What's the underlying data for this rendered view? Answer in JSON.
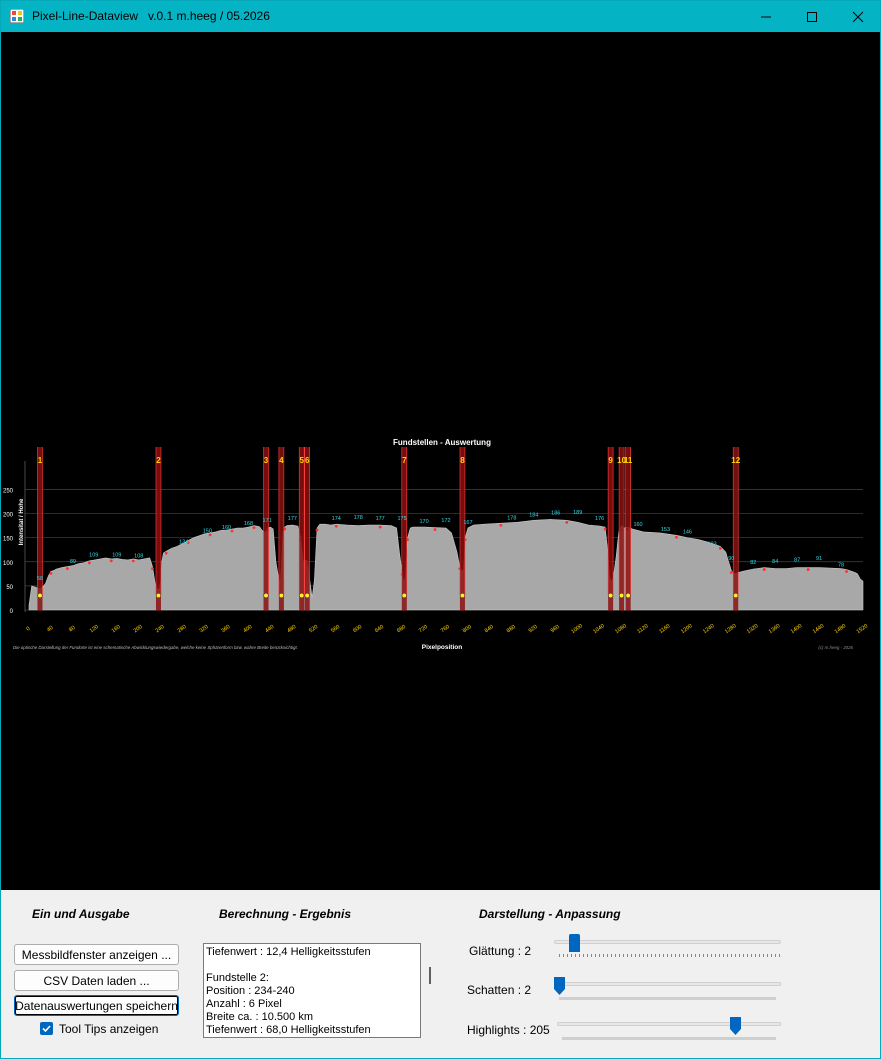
{
  "window": {
    "title": "Pixel-Line-Dataview   v.0.1 m.heeg / 05.2026",
    "colors": {
      "titlebar": "#04b4c4",
      "canvas": "#000000",
      "accent": "#0067c0"
    }
  },
  "chart_data": {
    "type": "area",
    "title": "Fundstellen - Auswertung",
    "xlabel": "Pixelposition",
    "ylabel": "Intensitat / Hohe",
    "xlim": [
      0,
      1520
    ],
    "ylim": [
      0,
      280
    ],
    "x_ticks": [
      "0",
      "40",
      "80",
      "120",
      "160",
      "200",
      "240",
      "280",
      "320",
      "360",
      "400",
      "440",
      "480",
      "520",
      "560",
      "600",
      "640",
      "680",
      "720",
      "760",
      "800",
      "840",
      "880",
      "920",
      "960",
      "1000",
      "1040",
      "1080",
      "1120",
      "1160",
      "1200",
      "1240",
      "1280",
      "1320",
      "1360",
      "1400",
      "1440",
      "1480",
      "1520"
    ],
    "y_ticks": [
      "0",
      "50",
      "100",
      "150",
      "200",
      "250"
    ],
    "grid": true,
    "note": "Die optische Darstellung der Fundorte ist eine schematische Abwicklungswiedergabe, welche keine Sphärenform bzw. wahre Breite berücksichtigt.",
    "copyright": "(c) m.heeg - 2026",
    "profile_x": [
      0,
      5,
      10,
      15,
      20,
      25,
      30,
      35,
      40,
      45,
      50,
      60,
      70,
      80,
      90,
      100,
      110,
      120,
      130,
      140,
      150,
      160,
      170,
      180,
      190,
      200,
      210,
      220,
      225,
      230,
      234,
      236,
      238,
      240,
      242,
      245,
      250,
      260,
      270,
      280,
      290,
      300,
      310,
      320,
      330,
      340,
      350,
      360,
      370,
      380,
      390,
      400,
      410,
      420,
      425,
      430,
      435,
      440,
      445,
      450,
      455,
      458,
      460,
      463,
      466,
      470,
      480,
      490,
      495,
      500,
      503,
      505,
      508,
      512,
      516,
      520,
      525,
      530,
      540,
      550,
      560,
      580,
      600,
      620,
      640,
      660,
      670,
      675,
      680,
      682,
      684,
      686,
      690,
      695,
      700,
      720,
      740,
      760,
      770,
      780,
      785,
      788,
      790,
      792,
      795,
      800,
      810,
      830,
      860,
      890,
      920,
      950,
      980,
      1000,
      1020,
      1040,
      1050,
      1055,
      1058,
      1060,
      1062,
      1065,
      1070,
      1075,
      1078,
      1080,
      1082,
      1085,
      1090,
      1100,
      1120,
      1150,
      1180,
      1200,
      1220,
      1240,
      1260,
      1270,
      1275,
      1278,
      1280,
      1285,
      1300,
      1320,
      1340,
      1360,
      1380,
      1400,
      1420,
      1440,
      1460,
      1480,
      1490,
      1500,
      1505,
      1510,
      1515,
      1520
    ],
    "profile_y": [
      10,
      50,
      48,
      46,
      44,
      48,
      55,
      70,
      80,
      82,
      85,
      88,
      90,
      92,
      96,
      98,
      102,
      104,
      106,
      108,
      106,
      107,
      105,
      104,
      106,
      104,
      106,
      108,
      90,
      55,
      44,
      43,
      45,
      60,
      100,
      118,
      122,
      128,
      132,
      138,
      144,
      150,
      154,
      158,
      160,
      162,
      165,
      166,
      168,
      170,
      170,
      172,
      175,
      173,
      165,
      160,
      170,
      172,
      168,
      100,
      65,
      60,
      90,
      160,
      172,
      175,
      176,
      174,
      150,
      98,
      102,
      104,
      100,
      60,
      26,
      60,
      170,
      178,
      178,
      176,
      178,
      176,
      175,
      176,
      176,
      175,
      170,
      120,
      78,
      62,
      60,
      70,
      150,
      170,
      172,
      172,
      171,
      170,
      160,
      120,
      90,
      82,
      80,
      85,
      150,
      170,
      176,
      178,
      180,
      182,
      186,
      188,
      186,
      182,
      176,
      174,
      172,
      120,
      70,
      62,
      60,
      68,
      110,
      162,
      170,
      175,
      172,
      170,
      172,
      168,
      162,
      160,
      155,
      150,
      146,
      140,
      132,
      120,
      100,
      90,
      82,
      75,
      80,
      85,
      88,
      86,
      86,
      88,
      88,
      88,
      87,
      86,
      84,
      80,
      78,
      75,
      64,
      60,
      50,
      30,
      20
    ],
    "markers": [
      {
        "label": "1",
        "x": 20
      },
      {
        "label": "2",
        "x": 236
      },
      {
        "label": "3",
        "x": 432
      },
      {
        "label": "4",
        "x": 460
      },
      {
        "label": "5",
        "x": 497
      },
      {
        "label": "6",
        "x": 507
      },
      {
        "label": "7",
        "x": 684
      },
      {
        "label": "8",
        "x": 790
      },
      {
        "label": "9",
        "x": 1060
      },
      {
        "label": "10",
        "x": 1080
      },
      {
        "label": "11",
        "x": 1092
      },
      {
        "label": "12",
        "x": 1288
      }
    ],
    "value_labels": [
      {
        "x": 20,
        "y": 56,
        "text": "58"
      },
      {
        "x": 80,
        "y": 91,
        "text": "89"
      },
      {
        "x": 118,
        "y": 105,
        "text": "109"
      },
      {
        "x": 160,
        "y": 105,
        "text": "109"
      },
      {
        "x": 200,
        "y": 103,
        "text": "108"
      },
      {
        "x": 282,
        "y": 132,
        "text": "134"
      },
      {
        "x": 325,
        "y": 155,
        "text": "150"
      },
      {
        "x": 360,
        "y": 162,
        "text": "160"
      },
      {
        "x": 400,
        "y": 170,
        "text": "168"
      },
      {
        "x": 434,
        "y": 176,
        "text": "171"
      },
      {
        "x": 480,
        "y": 180,
        "text": "177"
      },
      {
        "x": 560,
        "y": 180,
        "text": "174"
      },
      {
        "x": 600,
        "y": 183,
        "text": "178"
      },
      {
        "x": 640,
        "y": 180,
        "text": "177"
      },
      {
        "x": 680,
        "y": 180,
        "text": "175"
      },
      {
        "x": 720,
        "y": 174,
        "text": "170"
      },
      {
        "x": 760,
        "y": 176,
        "text": "172"
      },
      {
        "x": 800,
        "y": 172,
        "text": "167"
      },
      {
        "x": 880,
        "y": 182,
        "text": "178"
      },
      {
        "x": 920,
        "y": 188,
        "text": "184"
      },
      {
        "x": 960,
        "y": 192,
        "text": "186"
      },
      {
        "x": 1000,
        "y": 193,
        "text": "189"
      },
      {
        "x": 1040,
        "y": 180,
        "text": "176"
      },
      {
        "x": 1110,
        "y": 168,
        "text": "160"
      },
      {
        "x": 1160,
        "y": 158,
        "text": "153"
      },
      {
        "x": 1200,
        "y": 152,
        "text": "146"
      },
      {
        "x": 1245,
        "y": 128,
        "text": "123"
      },
      {
        "x": 1280,
        "y": 97,
        "text": "90"
      },
      {
        "x": 1320,
        "y": 89,
        "text": "82"
      },
      {
        "x": 1360,
        "y": 91,
        "text": "84"
      },
      {
        "x": 1400,
        "y": 94,
        "text": "87"
      },
      {
        "x": 1440,
        "y": 98,
        "text": "91"
      },
      {
        "x": 1480,
        "y": 84,
        "text": "78"
      }
    ]
  },
  "panels": {
    "io": {
      "heading": "Ein und Ausgabe",
      "btn_show": "Messbildfenster anzeigen ...",
      "btn_csv": "CSV Daten laden ...",
      "btn_save": "Datenauswertungen speichern",
      "tooltips_label": "Tool Tips anzeigen",
      "tooltips_checked": true
    },
    "result": {
      "heading": "Berechnung - Ergebnis",
      "lines": [
        "Tiefenwert : 12,4 Helligkeitsstufen",
        "",
        "Fundstelle 2:",
        "Position : 234-240",
        "Anzahl : 6 Pixel",
        "Breite ca. : 10.500 km",
        "Tiefenwert : 68,0 Helligkeitsstufen"
      ]
    },
    "display": {
      "heading": "Darstellung - Anpassung",
      "smoothing_label": "Glättung : 2",
      "shadow_label": "Schatten : 2",
      "highlights_label": "Highlights : 205",
      "smoothing_level": 0.05,
      "shadow_level": 0.0,
      "highlights_level": 0.8
    }
  }
}
